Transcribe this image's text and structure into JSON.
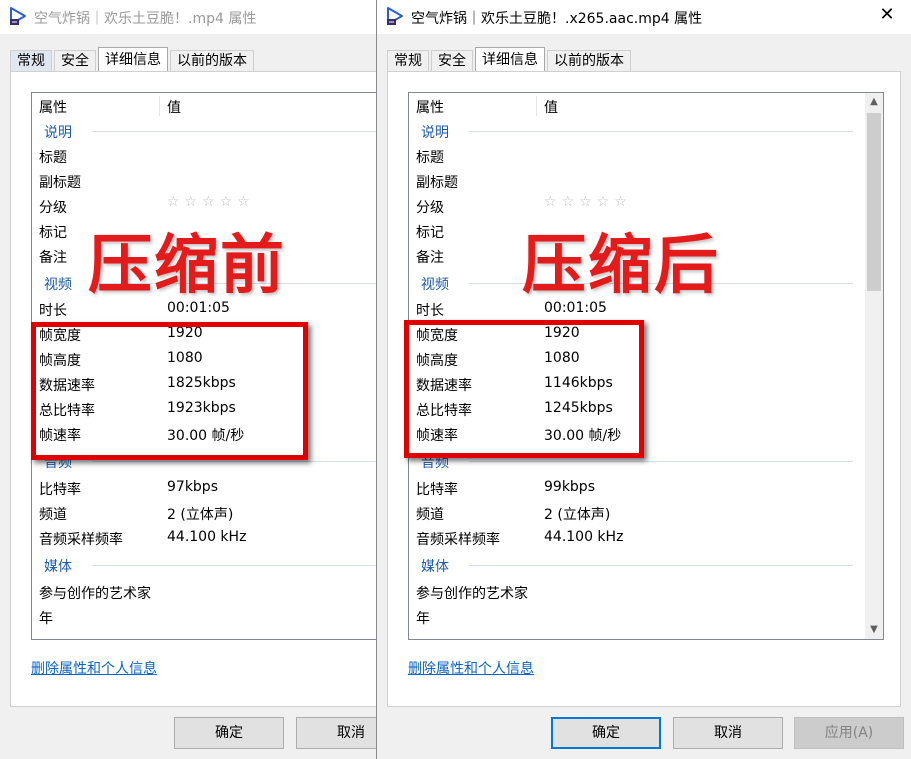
{
  "left_window": {
    "title": "空气炸锅｜欢乐土豆脆！.mp4 属性",
    "tabs": [
      "常规",
      "安全",
      "详细信息",
      "以前的版本"
    ],
    "columns": {
      "property": "属性",
      "value": "值"
    },
    "groups": {
      "description": "说明",
      "video": "视频",
      "audio": "音频",
      "media": "媒体"
    },
    "description_rows": [
      {
        "k": "标题",
        "v": ""
      },
      {
        "k": "副标题",
        "v": ""
      },
      {
        "k": "分级",
        "v": ""
      },
      {
        "k": "标记",
        "v": ""
      },
      {
        "k": "备注",
        "v": ""
      }
    ],
    "rating_stars": "☆☆☆☆☆",
    "video_rows": [
      {
        "k": "时长",
        "v": "00:01:05"
      },
      {
        "k": "帧宽度",
        "v": "1920"
      },
      {
        "k": "帧高度",
        "v": "1080"
      },
      {
        "k": "数据速率",
        "v": "1825kbps"
      },
      {
        "k": "总比特率",
        "v": "1923kbps"
      },
      {
        "k": "帧速率",
        "v": "30.00 帧/秒"
      }
    ],
    "audio_rows": [
      {
        "k": "比特率",
        "v": "97kbps"
      },
      {
        "k": "频道",
        "v": "2 (立体声)"
      },
      {
        "k": "音频采样频率",
        "v": "44.100 kHz"
      }
    ],
    "media_rows": [
      {
        "k": "参与创作的艺术家",
        "v": ""
      },
      {
        "k": "年",
        "v": ""
      }
    ],
    "remove_link": "删除属性和个人信息",
    "buttons": {
      "ok": "确定",
      "cancel": "取消"
    },
    "overlay": "压缩前"
  },
  "right_window": {
    "title": "空气炸锅｜欢乐土豆脆！.x265.aac.mp4 属性",
    "close_glyph": "✕",
    "tabs": [
      "常规",
      "安全",
      "详细信息",
      "以前的版本"
    ],
    "columns": {
      "property": "属性",
      "value": "值"
    },
    "groups": {
      "description": "说明",
      "video": "视频",
      "audio": "音频",
      "media": "媒体"
    },
    "description_rows": [
      {
        "k": "标题",
        "v": ""
      },
      {
        "k": "副标题",
        "v": ""
      },
      {
        "k": "分级",
        "v": ""
      },
      {
        "k": "标记",
        "v": ""
      },
      {
        "k": "备注",
        "v": ""
      }
    ],
    "rating_stars": "☆☆☆☆☆",
    "video_rows": [
      {
        "k": "时长",
        "v": "00:01:05"
      },
      {
        "k": "帧宽度",
        "v": "1920"
      },
      {
        "k": "帧高度",
        "v": "1080"
      },
      {
        "k": "数据速率",
        "v": "1146kbps"
      },
      {
        "k": "总比特率",
        "v": "1245kbps"
      },
      {
        "k": "帧速率",
        "v": "30.00 帧/秒"
      }
    ],
    "audio_rows": [
      {
        "k": "比特率",
        "v": "99kbps"
      },
      {
        "k": "频道",
        "v": "2 (立体声)"
      },
      {
        "k": "音频采样频率",
        "v": "44.100 kHz"
      }
    ],
    "media_rows": [
      {
        "k": "参与创作的艺术家",
        "v": ""
      },
      {
        "k": "年",
        "v": ""
      }
    ],
    "remove_link": "删除属性和个人信息",
    "buttons": {
      "ok": "确定",
      "cancel": "取消",
      "apply": "应用(A)"
    },
    "overlay": "压缩后",
    "scroll_up_glyph": "▲",
    "scroll_down_glyph": "▼"
  },
  "colors": {
    "highlight_red": "#e10000",
    "link_blue": "#0b63c4",
    "group_blue": "#1e5aa8",
    "default_button_border": "#0078d7"
  }
}
